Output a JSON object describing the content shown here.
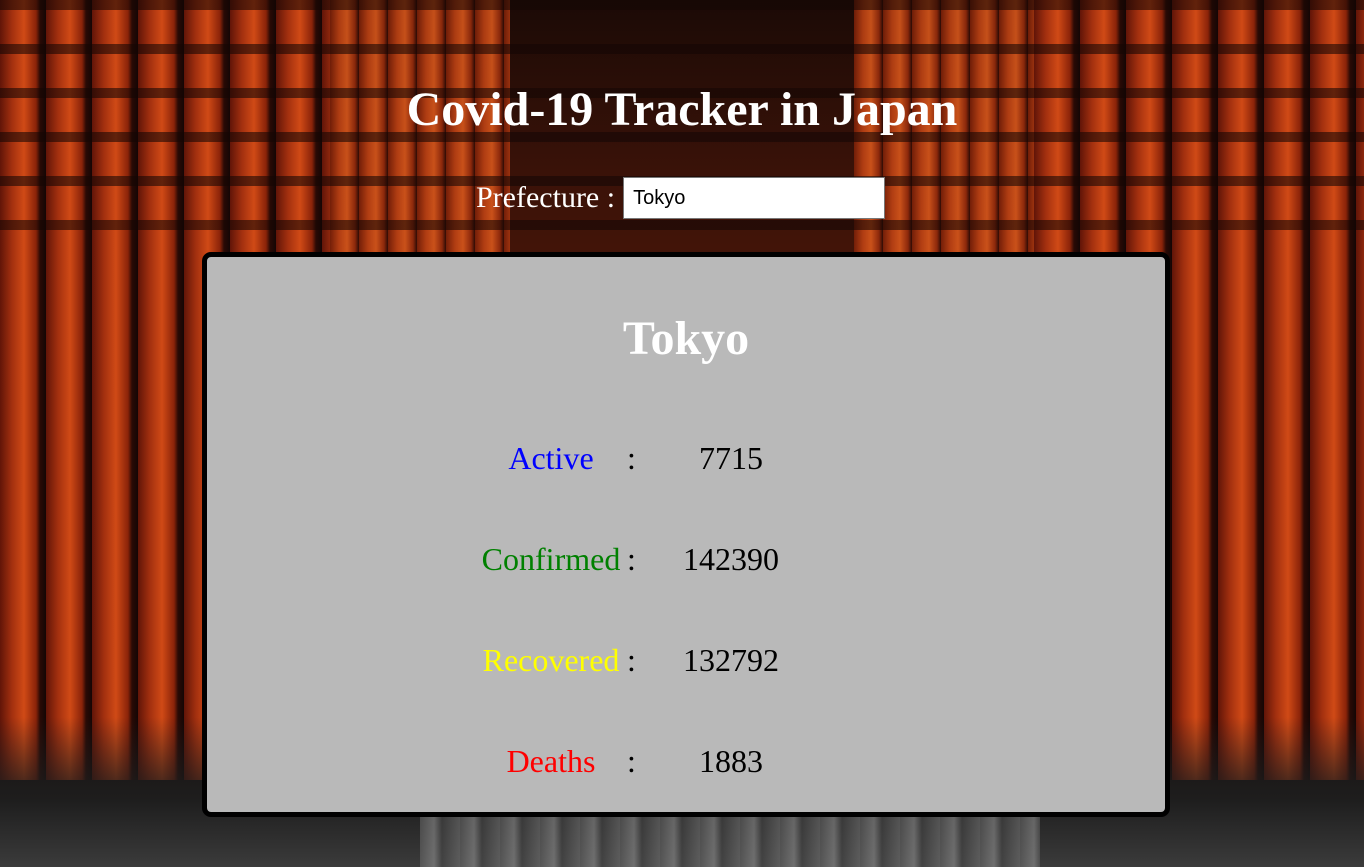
{
  "header": {
    "title": "Covid-19 Tracker in Japan"
  },
  "search": {
    "label": "Prefecture :",
    "value": "Tokyo"
  },
  "card": {
    "title": "Tokyo",
    "stats": [
      {
        "label": "Active",
        "value": "7715",
        "color": "#0000ff"
      },
      {
        "label": "Confirmed",
        "value": "142390",
        "color": "#008000"
      },
      {
        "label": "Recovered",
        "value": "132792",
        "color": "#ffff00"
      },
      {
        "label": "Deaths",
        "value": "1883",
        "color": "#ff0000"
      }
    ],
    "separator": ":"
  },
  "colors": {
    "card_background": "#b9b9b9",
    "card_border": "#000000",
    "title_text": "#ffffff"
  }
}
